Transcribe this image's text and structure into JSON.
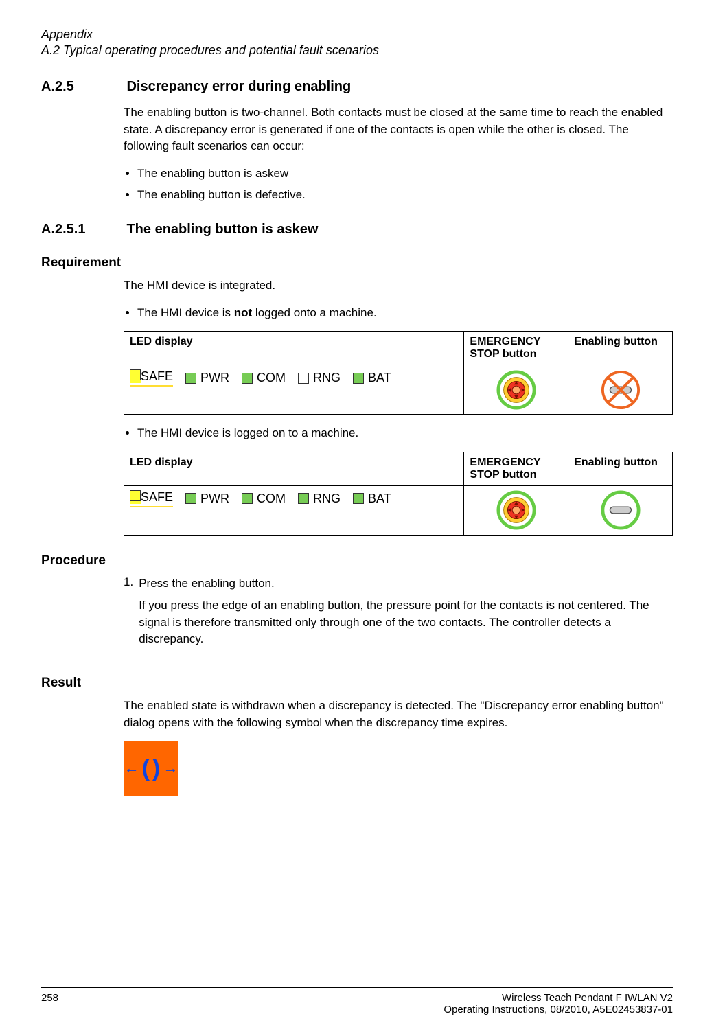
{
  "header": {
    "chapter": "Appendix",
    "section_path": "A.2 Typical operating procedures and potential fault scenarios"
  },
  "s1": {
    "num": "A.2.5",
    "title": "Discrepancy error during enabling",
    "p1": "The enabling button is two-channel. Both contacts must be closed at the same time to reach the enabled state. A discrepancy error is generated if one of the contacts is open while the other is closed. The following fault scenarios can occur:",
    "b1": "The enabling button is askew",
    "b2": "The enabling button is defective."
  },
  "s2": {
    "num": "A.2.5.1",
    "title": "The enabling button is askew"
  },
  "req": {
    "heading": "Requirement",
    "p1": "The HMI device is integrated.",
    "b1_pre": "The HMI device is ",
    "b1_bold": "not",
    "b1_post": " logged onto a machine.",
    "b2": "The HMI device is logged on to a machine."
  },
  "table": {
    "h1": "LED display",
    "h2": "EMERGENCY STOP button",
    "h3": "Enabling button",
    "leds": {
      "safe": "SAFE",
      "pwr": "PWR",
      "com": "COM",
      "rng": "RNG",
      "bat": "BAT"
    }
  },
  "proc": {
    "heading": "Procedure",
    "step1_num": "1.",
    "step1": "Press the enabling button.",
    "step1_detail": "If you press the edge of an enabling button, the pressure point for the contacts is not centered. The signal is therefore transmitted only through one of the two contacts. The controller detects a discrepancy."
  },
  "result": {
    "heading": "Result",
    "p1": "The enabled state is withdrawn when a discrepancy is detected. The \"Discrepancy error enabling button\" dialog opens with the following symbol when the discrepancy time expires."
  },
  "footer": {
    "page": "258",
    "doc_title": "Wireless Teach Pendant F IWLAN V2",
    "doc_info": "Operating Instructions, 08/2010, A5E02453837-01"
  }
}
